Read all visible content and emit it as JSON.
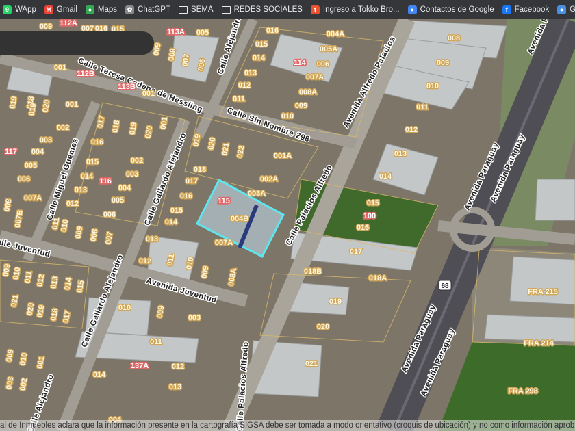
{
  "bookmarks": [
    {
      "label": "WApp",
      "icon": "whatsapp-icon",
      "color": "#25d366"
    },
    {
      "label": "Gmail",
      "icon": "gmail-icon",
      "color": "#ea4335"
    },
    {
      "label": "Maps",
      "icon": "maps-pin-icon",
      "color": "#34a853"
    },
    {
      "label": "ChatGPT",
      "icon": "chatgpt-icon",
      "color": "#888888"
    },
    {
      "label": "SEMA",
      "icon": "folder-icon",
      "color": "#35363a"
    },
    {
      "label": "REDES SOCIALES",
      "icon": "folder-icon",
      "color": "#35363a"
    },
    {
      "label": "Ingreso a Tokko Bro...",
      "icon": "tokko-icon",
      "color": "#e8542f"
    },
    {
      "label": "Contactos de Google",
      "icon": "contacts-icon",
      "color": "#4285f4"
    },
    {
      "label": "Facebook",
      "icon": "facebook-icon",
      "color": "#1877f2"
    },
    {
      "label": "Google",
      "icon": "google-icon",
      "color": "#4a90e2"
    }
  ],
  "map": {
    "highlight_color": "#5ee6ee",
    "streets": [
      "Calle Teresa Cadena de Hessling",
      "Calle Sin Nombre 298",
      "Calle Alejandro",
      "Avenida Alfredo Palacios",
      "Calle Miguel Guemes",
      "Calle Gallardo Alejandro",
      "Calle Palacios Alfredo",
      "Calle Juventud",
      "Avenida Juventud",
      "Calle Gallardo Alejandro",
      "Avenida Paraguay",
      "Avenida Paraguay",
      "Avenida Paraguay",
      "Avenida Paraguay",
      "Avenida Paraguay",
      "Calle Palacios Alfredo",
      "Calle Alejandro"
    ],
    "parcels": [
      "009",
      "007",
      "016",
      "015",
      "005",
      "009",
      "008",
      "007",
      "006",
      "001",
      "001",
      "019",
      "018",
      "019",
      "020",
      "001",
      "002",
      "003",
      "004",
      "005",
      "006",
      "007A",
      "008",
      "007B",
      "017",
      "018",
      "019",
      "020",
      "001",
      "016",
      "015",
      "014",
      "013",
      "012",
      "011",
      "010",
      "009",
      "008",
      "007",
      "002",
      "003",
      "004",
      "005",
      "006",
      "016",
      "015",
      "014",
      "013",
      "012",
      "011",
      "004A",
      "005A",
      "006",
      "007A",
      "008A",
      "009",
      "010",
      "008",
      "009",
      "010",
      "011",
      "012",
      "013",
      "014",
      "019",
      "020",
      "021",
      "022",
      "001A",
      "018",
      "017",
      "016",
      "015",
      "014",
      "013",
      "012",
      "011",
      "010",
      "009",
      "008A",
      "002A",
      "003A",
      "004B",
      "007A",
      "015",
      "016",
      "017",
      "018B",
      "018A",
      "019",
      "020",
      "021",
      "010",
      "009",
      "003",
      "011",
      "012",
      "014",
      "013",
      "004",
      "009",
      "010",
      "011",
      "012",
      "013",
      "014",
      "015",
      "021",
      "020",
      "019",
      "018",
      "017",
      "009",
      "010",
      "003",
      "002",
      "001"
    ],
    "blocks": [
      "112A",
      "113A",
      "112B",
      "113B",
      "114",
      "117",
      "116",
      "115",
      "100",
      "137A"
    ],
    "fra": [
      "FRA 215",
      "FRA 214",
      "FRA 298"
    ],
    "route_shield": "68"
  },
  "disclaimer": "al de Inmuebles aclara que la información presente en la cartografía SIGSA debe ser tomada a modo orientativo (croquis de ubicación) y no como información aprobatoria de plano"
}
